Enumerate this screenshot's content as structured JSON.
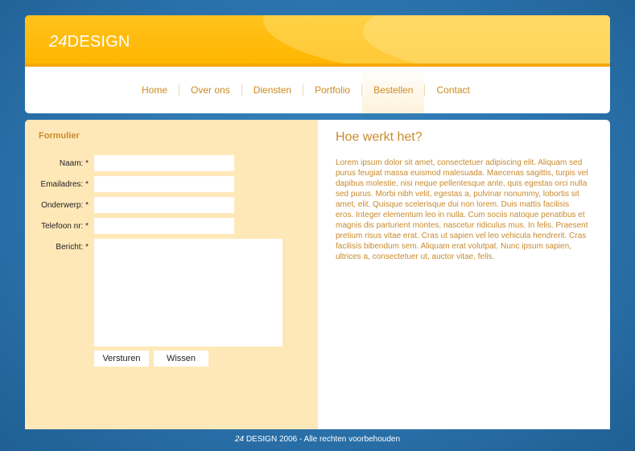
{
  "header": {
    "logo_number": "24",
    "logo_text": "DESIGN"
  },
  "nav": {
    "items": [
      {
        "label": "Home"
      },
      {
        "label": "Over ons"
      },
      {
        "label": "Diensten"
      },
      {
        "label": "Portfolio"
      },
      {
        "label": "Bestellen",
        "active": true
      },
      {
        "label": "Contact"
      }
    ]
  },
  "form": {
    "title": "Formulier",
    "fields": [
      {
        "label": "Naam: *",
        "value": ""
      },
      {
        "label": "Emailadres: *",
        "value": ""
      },
      {
        "label": "Onderwerp: *",
        "value": ""
      },
      {
        "label": "Telefoon nr: *",
        "value": ""
      },
      {
        "label": "Bericht: *",
        "value": ""
      }
    ],
    "submit_label": "Versturen",
    "reset_label": "Wissen"
  },
  "content": {
    "heading": "Hoe werkt het?",
    "body": "Lorem ipsum dolor sit amet, consectetuer adipiscing elit. Aliquam sed purus feugiat massa euismod malesuada. Maecenas sagittis, turpis vel dapibus molestie, nisi neque pellentesque ante, quis egestas orci nulla sed purus. Morbi nibh velit, egestas a, pulvinar nonummy, lobortis sit amet, elit. Quisque scelerisque dui non lorem. Duis mattis facilisis eros. Integer elementum leo in nulla. Cum sociis natoque penatibus et magnis dis parturient montes, nascetur ridiculus mus. In felis. Praesent pretium risus vitae erat. Cras ut sapien vel leo vehicula hendrerit. Cras facilisis bibendum sem. Aliquam erat volutpat. Nunc ipsum sapien, ultrices a, consectetuer ut, auctor vitae, felis."
  },
  "footer": {
    "number": "24",
    "text": " DESIGN 2006 - Alle rechten voorbehouden"
  },
  "colors": {
    "brand_orange": "#ffb500",
    "accent_text": "#c98a2c",
    "form_panel": "#ffe8b8",
    "page_blue": "#2c74ae"
  }
}
